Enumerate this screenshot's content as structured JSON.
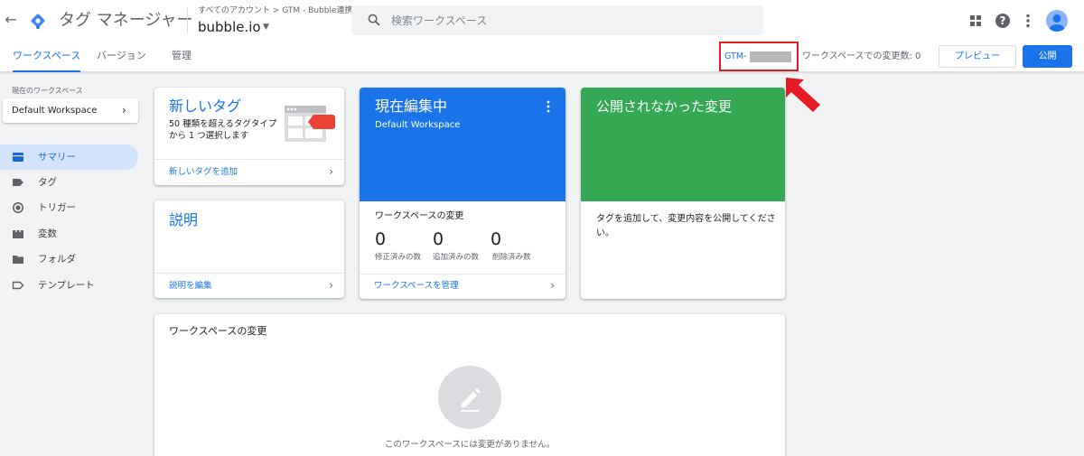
{
  "app": {
    "product_name": "タグ マネージャー",
    "breadcrumb": "すべてのアカウント > GTM - Bubble連携",
    "container_name": "bubble.io",
    "search_placeholder": "検索ワークスペース"
  },
  "subnav": {
    "tabs": [
      "ワークスペース",
      "バージョン",
      "管理"
    ],
    "active_tab": "ワークスペース",
    "container_id_prefix": "GTM-",
    "change_count_label": "ワークスペースでの変更数: 0",
    "preview_label": "プレビュー",
    "publish_label": "公開"
  },
  "sidebar": {
    "workspace_label": "現在のワークスペース",
    "workspace_name": "Default Workspace",
    "items": [
      {
        "label": "サマリー",
        "icon": "summary-icon",
        "active": true
      },
      {
        "label": "タグ",
        "icon": "tag-icon",
        "active": false
      },
      {
        "label": "トリガー",
        "icon": "trigger-icon",
        "active": false
      },
      {
        "label": "変数",
        "icon": "variables-icon",
        "active": false
      },
      {
        "label": "フォルダ",
        "icon": "folder-icon",
        "active": false
      },
      {
        "label": "テンプレート",
        "icon": "template-icon",
        "active": false
      }
    ]
  },
  "cards": {
    "new_tag": {
      "title": "新しいタグ",
      "description": "50 種類を超えるタグタイプから 1 つ選択します",
      "link": "新しいタグを追加"
    },
    "description": {
      "title": "説明",
      "link": "説明を編集"
    },
    "now_editing": {
      "title": "現在編集中",
      "workspace": "Default Workspace",
      "changes_label": "ワークスペースの変更",
      "stats": [
        {
          "value": "0",
          "label": "修正済みの数"
        },
        {
          "value": "0",
          "label": "追加済みの数"
        },
        {
          "value": "0",
          "label": "削除済み数"
        }
      ],
      "link": "ワークスペースを管理"
    },
    "unpublished": {
      "title": "公開されなかった変更",
      "body": "タグを追加して、変更内容を公開してください。"
    },
    "workspace_changes": {
      "title": "ワークスペースの変更",
      "empty_text": "このワークスペースには変更がありません。"
    }
  },
  "colors": {
    "accent": "#1a73e8",
    "green": "#34a853",
    "highlight_red": "#e51c23"
  }
}
